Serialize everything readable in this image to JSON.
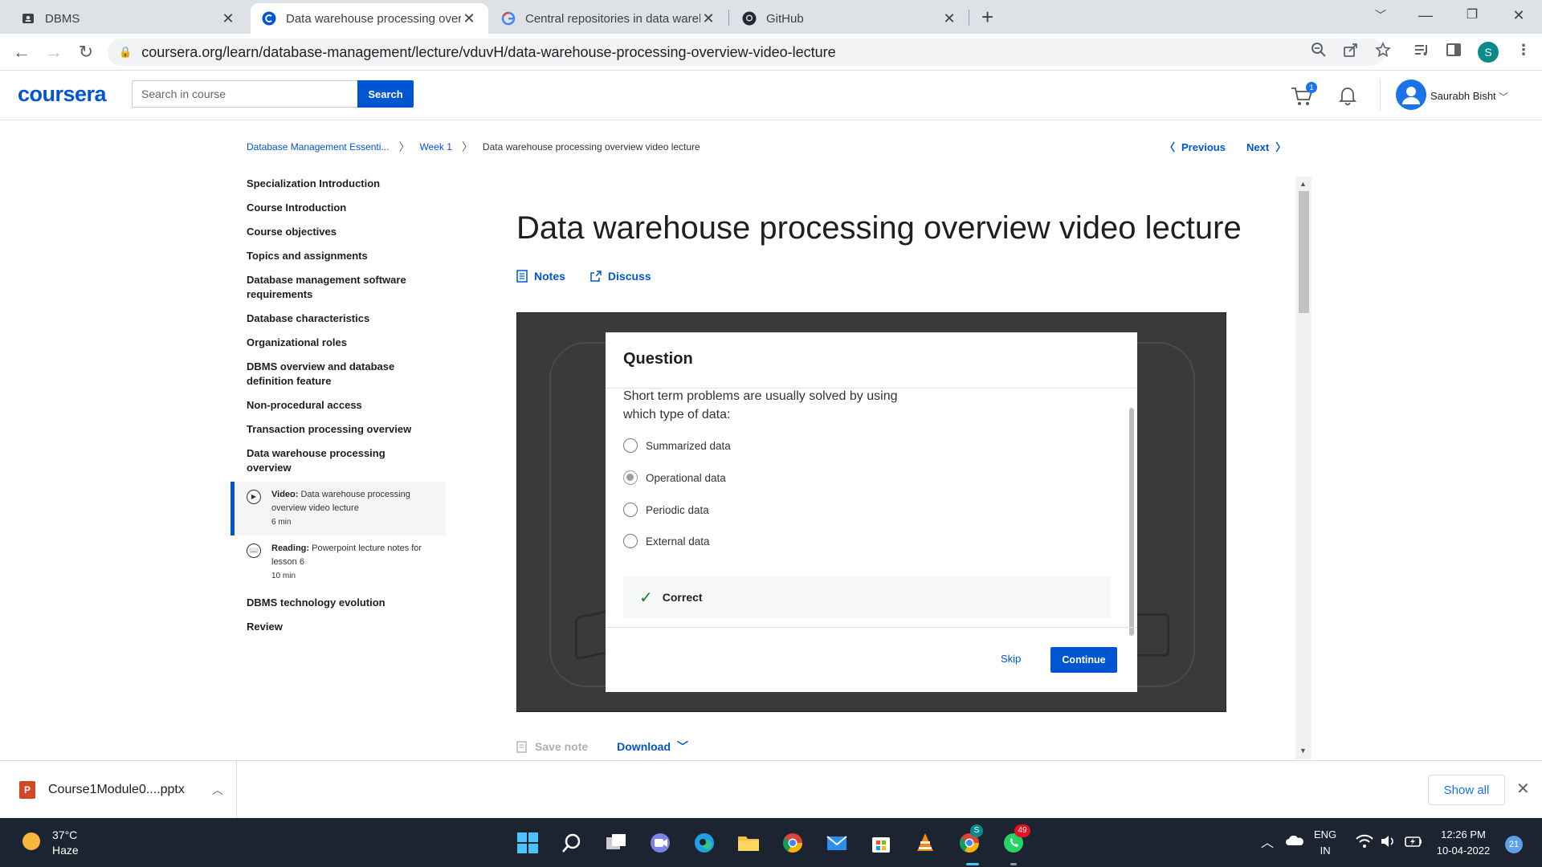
{
  "browser": {
    "tabs": [
      {
        "title": "DBMS",
        "icon": "contact-icon"
      },
      {
        "title": "Data warehouse processing overview video lecture",
        "icon": "coursera-icon"
      },
      {
        "title": "Central repositories in data warehouse",
        "icon": "google-icon"
      },
      {
        "title": "GitHub",
        "icon": "github-icon"
      }
    ],
    "url": "coursera.org/learn/database-management/lecture/vduvH/data-warehouse-processing-overview-video-lecture",
    "profile_initial": "S"
  },
  "header": {
    "logo": "coursera",
    "search_placeholder": "Search in course",
    "search_button": "Search",
    "cart_count": "1",
    "user_name": "Saurabh Bisht"
  },
  "breadcrumb": {
    "course": "Database Management Essenti...",
    "week": "Week 1",
    "current": "Data warehouse processing overview video lecture"
  },
  "nav": {
    "previous": "Previous",
    "next": "Next"
  },
  "sidebar": {
    "items": [
      "Specialization Introduction",
      "Course Introduction",
      "Course objectives",
      "Topics and assignments",
      "Database management software requirements",
      "Database characteristics",
      "Organizational roles",
      "DBMS overview and database definition feature",
      "Non-procedural access",
      "Transaction processing overview",
      "Data warehouse processing overview"
    ],
    "sub_items": [
      {
        "type": "Video:",
        "title": "Data warehouse processing overview video lecture",
        "duration": "6 min"
      },
      {
        "type": "Reading:",
        "title": "Powerpoint lecture notes for lesson 6",
        "duration": "10 min"
      }
    ],
    "after_items": [
      "DBMS technology evolution",
      "Review"
    ]
  },
  "main": {
    "title": "Data warehouse processing overview video lecture",
    "notes_label": "Notes",
    "discuss_label": "Discuss",
    "save_note_label": "Save note",
    "download_label": "Download"
  },
  "quiz": {
    "heading": "Question",
    "question": "Short term problems are usually solved by using which type of data:",
    "options": [
      "Summarized data",
      "Operational data",
      "Periodic data",
      "External data"
    ],
    "selected_index": 1,
    "feedback": "Correct",
    "skip_label": "Skip",
    "continue_label": "Continue"
  },
  "downloads": {
    "file_name": "Course1Module0....pptx",
    "show_all": "Show all"
  },
  "taskbar": {
    "temperature": "37°C",
    "condition": "Haze",
    "language_line1": "ENG",
    "language_line2": "IN",
    "time": "12:26 PM",
    "date": "10-04-2022",
    "notification_count": "21",
    "whatsapp_badge": "49",
    "chrome_profile_badge": "S"
  },
  "colors": {
    "brand": "#0056d2",
    "taskbar": "#1c2431",
    "success": "#1e7b34"
  }
}
